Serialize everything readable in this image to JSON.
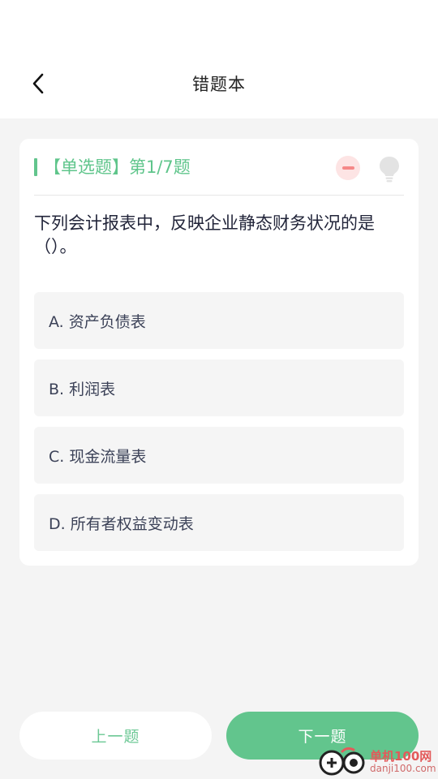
{
  "header": {
    "title": "错题本",
    "back_icon": "chevron-left-icon"
  },
  "question": {
    "type_label": "【单选题】第1/7题",
    "text": "下列会计报表中，反映企业静态财务状况的是（）。",
    "remove_icon": "minus-circle-icon",
    "hint_icon": "lightbulb-icon",
    "options": [
      {
        "label": "A. 资产负债表"
      },
      {
        "label": "B. 利润表"
      },
      {
        "label": "C. 现金流量表"
      },
      {
        "label": "D. 所有者权益变动表"
      }
    ]
  },
  "footer": {
    "prev_label": "上一题",
    "next_label": "下一题"
  },
  "watermark": {
    "name": "单机100网",
    "domain": "danji100.com"
  },
  "colors": {
    "accent": "#62c58d",
    "remove_bg": "#fde4e4",
    "remove_fg": "#f58888",
    "watermark": "#e35a5a"
  }
}
